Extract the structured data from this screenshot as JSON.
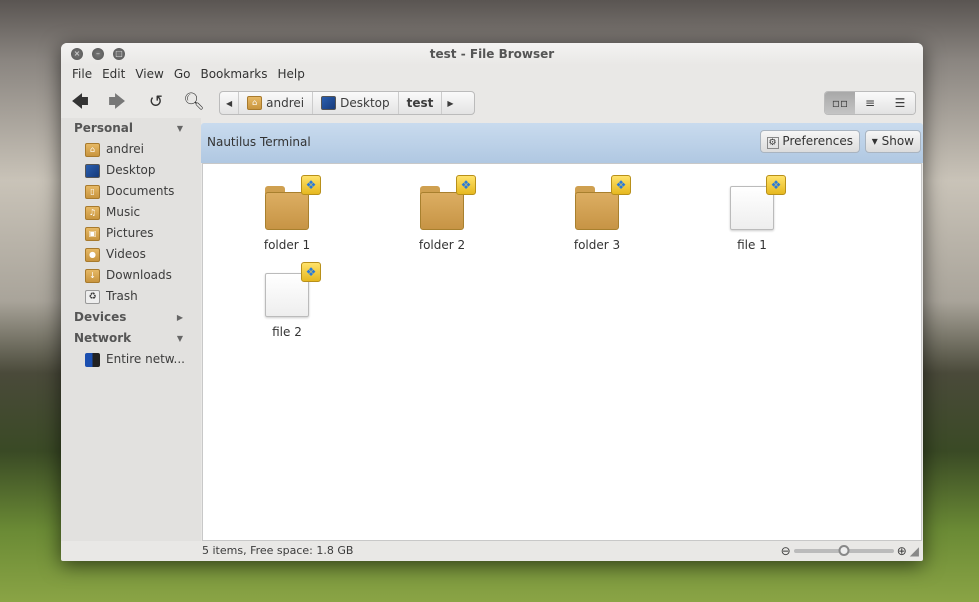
{
  "window": {
    "title": "test - File Browser"
  },
  "menu": [
    "File",
    "Edit",
    "View",
    "Go",
    "Bookmarks",
    "Help"
  ],
  "breadcrumb": [
    "andrei",
    "Desktop",
    "test"
  ],
  "sidebar": {
    "personal": {
      "label": "Personal",
      "items": [
        "andrei",
        "Desktop",
        "Documents",
        "Music",
        "Pictures",
        "Videos",
        "Downloads",
        "Trash"
      ]
    },
    "devices": {
      "label": "Devices"
    },
    "network": {
      "label": "Network",
      "items": [
        "Entire netw..."
      ]
    }
  },
  "terminal": {
    "label": "Nautilus Terminal",
    "preferences": "Preferences",
    "show": "▾ Show"
  },
  "items": [
    {
      "name": "folder 1",
      "type": "folder"
    },
    {
      "name": "folder 2",
      "type": "folder"
    },
    {
      "name": "folder 3",
      "type": "folder"
    },
    {
      "name": "file 1",
      "type": "file"
    },
    {
      "name": "file 2",
      "type": "file"
    }
  ],
  "status": {
    "text": "5 items, Free space: 1.8 GB",
    "zoom_level": 0.5
  }
}
